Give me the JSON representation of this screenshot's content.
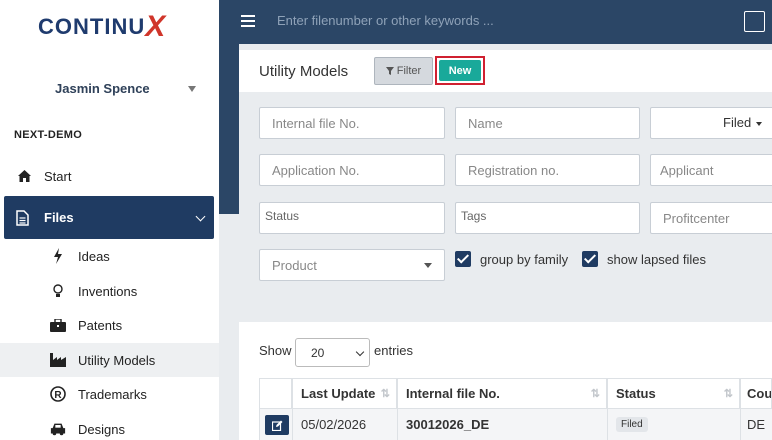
{
  "app": {
    "logo_text": "CONTINU",
    "logo_x": "X"
  },
  "user": {
    "name": "Jasmin Spence"
  },
  "workspace": "NEXT-DEMO",
  "nav": {
    "start": "Start",
    "files": "Files",
    "sub_items": [
      {
        "label": "Ideas",
        "icon": "bolt-icon"
      },
      {
        "label": "Inventions",
        "icon": "lightbulb-icon"
      },
      {
        "label": "Patents",
        "icon": "briefcase-icon"
      },
      {
        "label": "Utility Models",
        "icon": "industry-icon"
      },
      {
        "label": "Trademarks",
        "icon": "registered-icon"
      },
      {
        "label": "Designs",
        "icon": "car-icon"
      }
    ]
  },
  "search": {
    "placeholder": "Enter filenumber or other keywords ..."
  },
  "page": {
    "title": "Utility Models",
    "filter_label": "Filter",
    "new_label": "New"
  },
  "filters": {
    "internal_file_no": "Internal file No.",
    "name": "Name",
    "filed": "Filed",
    "application_no": "Application No.",
    "registration_no": "Registration no.",
    "applicant": "Applicant",
    "status": "Status",
    "tags": "Tags",
    "profitcenter": "Profitcenter",
    "product": "Product",
    "group_by_family": "group by family",
    "show_lapsed_files": "show lapsed files"
  },
  "table": {
    "show_label": "Show",
    "entries_value": "20",
    "entries_label": "entries",
    "columns": [
      "Last Update",
      "Internal file No.",
      "Status",
      "Cou"
    ],
    "rows": [
      {
        "last_update": "05/02/2026",
        "internal_file_no": "30012026_DE",
        "status": "Filed",
        "country": "DE"
      }
    ]
  }
}
